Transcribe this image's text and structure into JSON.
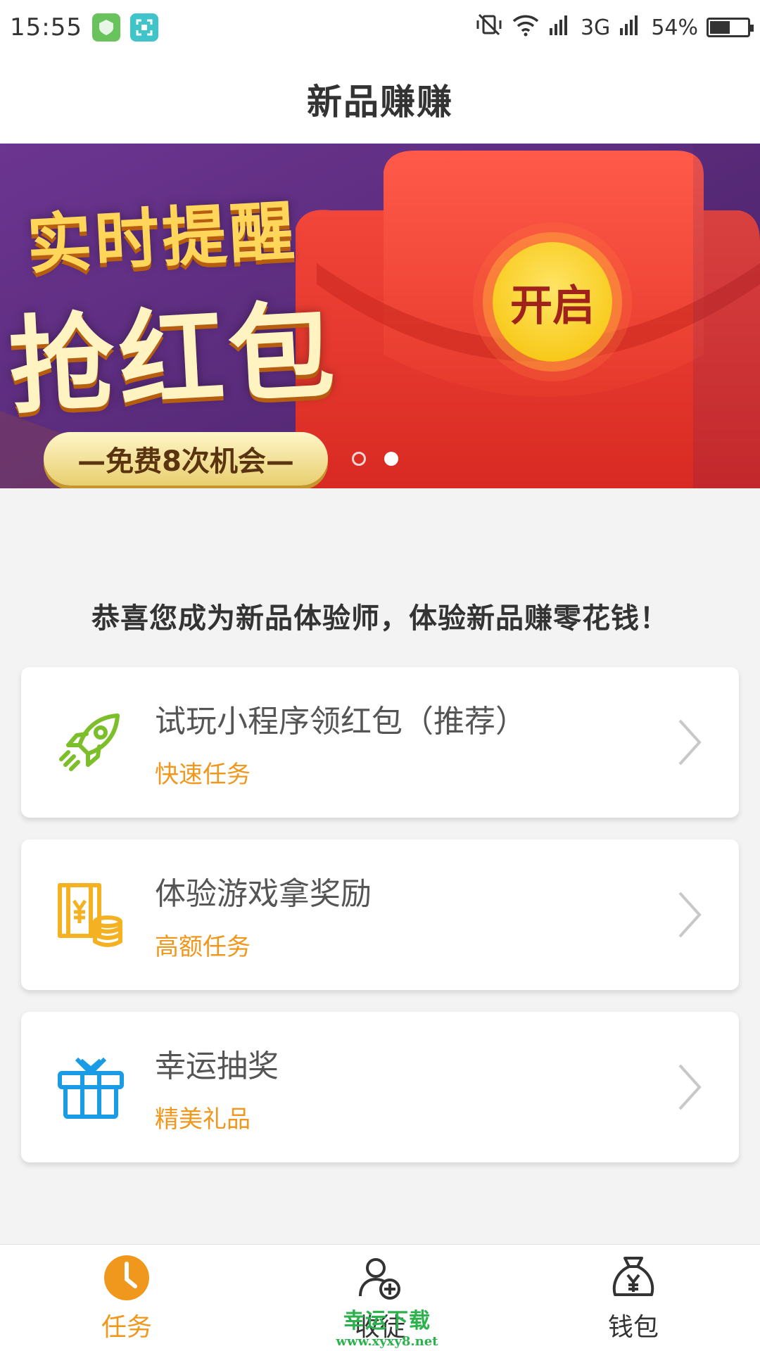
{
  "status_bar": {
    "time": "15:55",
    "network": "3G",
    "battery": "54%",
    "battery_level": 0.54,
    "icons": [
      "app-shield-icon",
      "screenshot-icon",
      "mute-icon",
      "wifi-icon",
      "signal-icon",
      "signal-icon-2",
      "battery-icon"
    ]
  },
  "header": {
    "title": "新品赚赚"
  },
  "banner": {
    "headline_line1": "实时提醒",
    "headline_line2": "抢红包",
    "pill_text": "—免费8次机会—",
    "open_button": "开启",
    "slides_total": 2,
    "active_slide": 2
  },
  "intro": {
    "text": "恭喜您成为新品体验师，体验新品赚零花钱！"
  },
  "tasks": [
    {
      "title": "试玩小程序领红包（推荐）",
      "subtitle": "快速任务",
      "icon": "rocket-icon"
    },
    {
      "title": "体验游戏拿奖励",
      "subtitle": "高额任务",
      "icon": "money-coins-icon"
    },
    {
      "title": "幸运抽奖",
      "subtitle": "精美礼品",
      "icon": "gift-icon"
    }
  ],
  "tab_bar": {
    "items": [
      {
        "label": "任务",
        "icon": "clock-icon",
        "active": true
      },
      {
        "label": "收徒",
        "icon": "add-user-icon",
        "active": false
      },
      {
        "label": "钱包",
        "icon": "money-bag-icon",
        "active": false
      }
    ]
  },
  "watermark": {
    "title": "幸运下载",
    "url": "www.xyxy8.net"
  },
  "colors": {
    "accent": "#f0981d",
    "rocket_green": "#7cbf2b",
    "money_orange": "#f4b223",
    "gift_blue": "#1a9be6",
    "banner_red": "#e8332a",
    "banner_purple": "#5a2b7c"
  }
}
